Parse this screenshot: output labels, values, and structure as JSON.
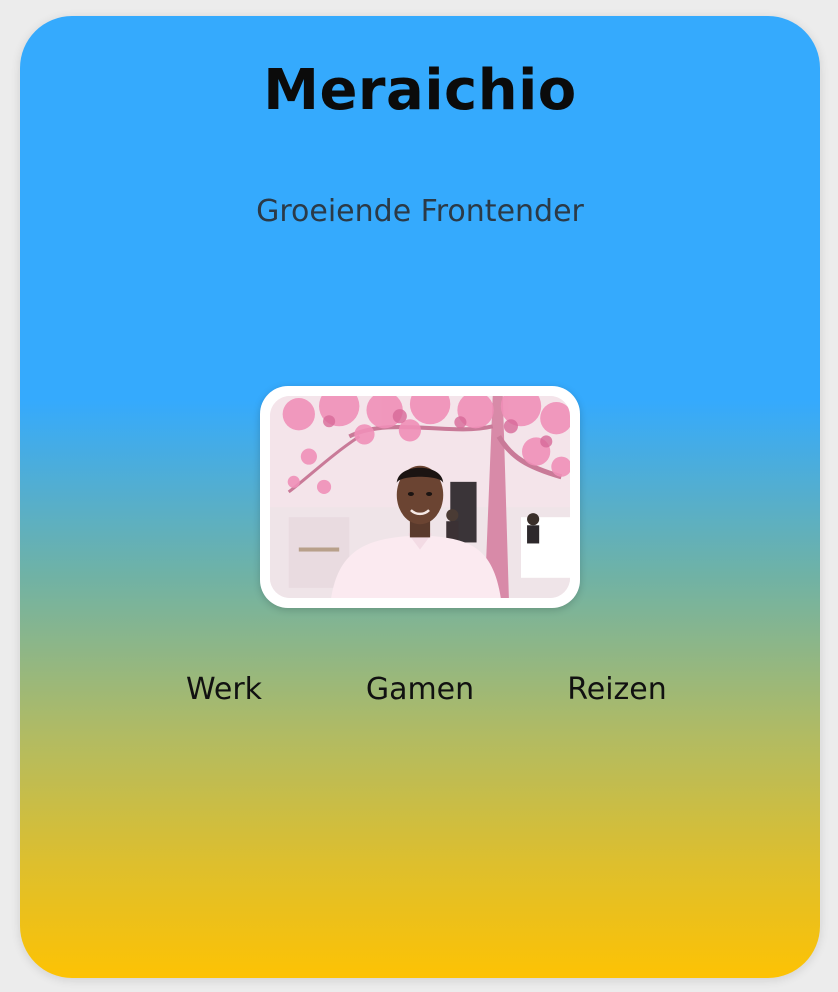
{
  "profile": {
    "name": "Meraichio",
    "tagline": "Groeiende Frontender"
  },
  "photo": {
    "icon": "profile-photo"
  },
  "hobbies": [
    {
      "label": "Werk"
    },
    {
      "label": "Gamen"
    },
    {
      "label": "Reizen"
    }
  ],
  "colors": {
    "gradient_top": "#35aafd",
    "gradient_bottom": "#fdc204",
    "frame": "#ffffff",
    "title_text": "#0b0b0b"
  }
}
